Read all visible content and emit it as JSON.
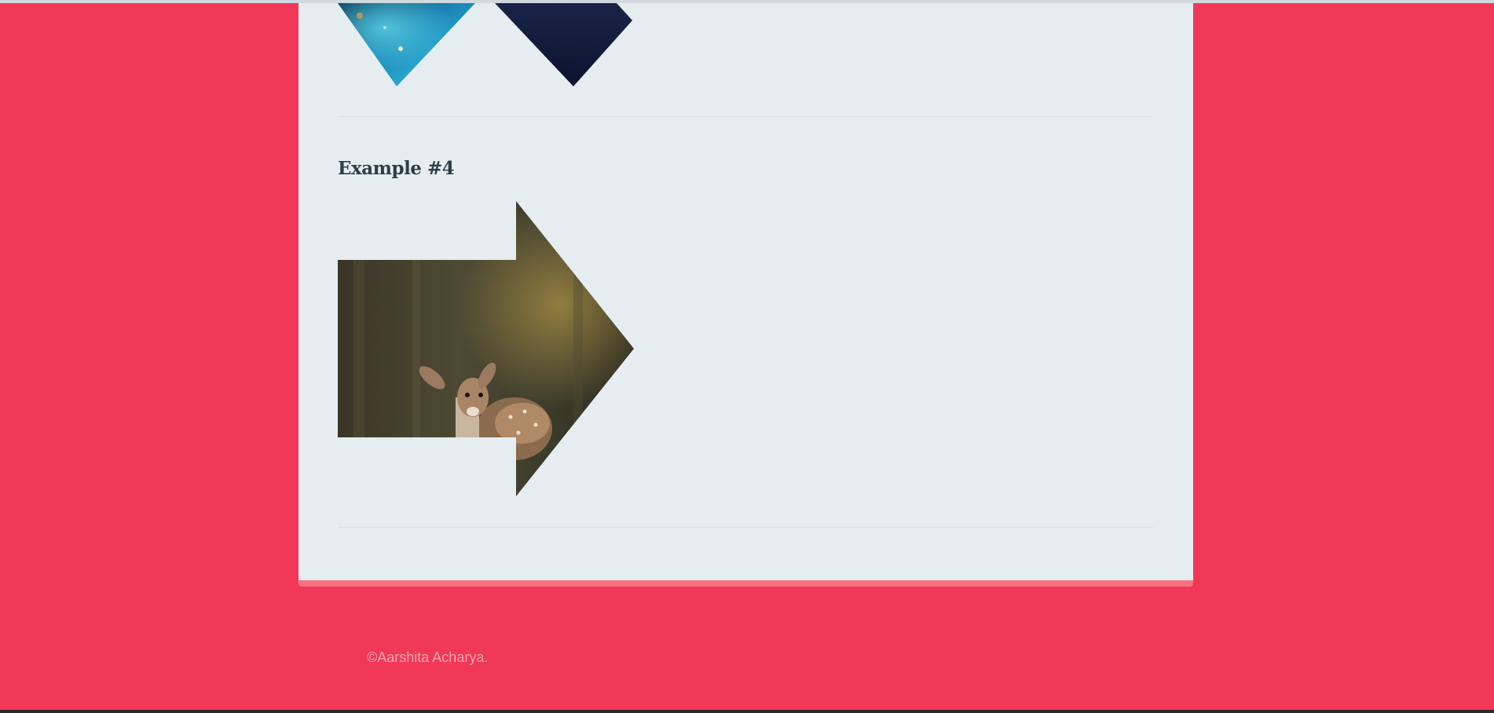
{
  "page": {
    "background_color": "#f23858",
    "card_color": "#e6edf0",
    "card_border_color": "#f7717f"
  },
  "content": {
    "example_heading": "Example #4"
  },
  "images": {
    "diamond_left": "ocean-aerial-photo",
    "diamond_right": "dark-night-sky-photo",
    "arrow": "deer-in-forest-photo"
  },
  "footer": {
    "copyright": "©Aarshita Acharya."
  }
}
